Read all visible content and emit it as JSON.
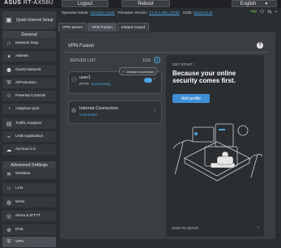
{
  "header": {
    "brand_logo": "ASUS",
    "model": "RT-AX58U",
    "logout_label": "Logout",
    "reboot_label": "Reboot",
    "language": "English"
  },
  "opbar": {
    "mode_label": "Operation Mode:",
    "mode_value": "Wireless router",
    "firmware_label": "Firmware Version:",
    "firmware_value": "3.0.0.4.388_23785",
    "ssid_label": "SSID:",
    "ssid_value": "BackArcLte",
    "app_label": "App"
  },
  "sidebar": {
    "qis_label": "Quick Internet Setup",
    "general_label": "General",
    "general_items": [
      {
        "label": "Network Map",
        "icon": "network-map-icon"
      },
      {
        "label": "AiMesh",
        "icon": "aimesh-icon"
      },
      {
        "label": "Guest Network",
        "icon": "guest-network-icon"
      },
      {
        "label": "AiProtection",
        "icon": "aiprotection-icon"
      },
      {
        "label": "Parental Controls",
        "icon": "parental-controls-icon"
      },
      {
        "label": "Adaptive QoS",
        "icon": "qos-icon"
      },
      {
        "label": "Traffic Analyzer",
        "icon": "traffic-analyzer-icon"
      },
      {
        "label": "USB Application",
        "icon": "usb-icon"
      },
      {
        "label": "AiCloud 2.0",
        "icon": "cloud-icon"
      }
    ],
    "advanced_label": "Advanced Settings",
    "advanced_items": [
      {
        "label": "Wireless",
        "icon": "wireless-icon"
      },
      {
        "label": "LAN",
        "icon": "lan-icon"
      },
      {
        "label": "WAN",
        "icon": "wan-icon"
      },
      {
        "label": "Alexa & IFTTT",
        "icon": "alexa-icon"
      },
      {
        "label": "IPv6",
        "icon": "ipv6-icon"
      },
      {
        "label": "VPN",
        "icon": "vpn-icon"
      }
    ]
  },
  "tabs": [
    "VPN Server",
    "VPN Fusion",
    "Instant Guard"
  ],
  "main": {
    "title": "VPN Fusion",
    "server_list_label": "SERVER LIST",
    "server_count": "1/16",
    "default_connection_label": "Default Connection",
    "servers": [
      {
        "name": "user1",
        "protocol": "PPTP",
        "status": "Connecting..."
      }
    ],
    "internet": {
      "name": "Internet Connection",
      "status": "Connected"
    }
  },
  "promo": {
    "get_start": "GET START :",
    "headline": "Because your online security comes first.",
    "add_profile_label": "Add profile",
    "howto_label": "HOW TO SETUP"
  },
  "colors": {
    "accent": "#3f8fd6",
    "link": "#4aa3df",
    "app_green": "#7fd14f"
  }
}
